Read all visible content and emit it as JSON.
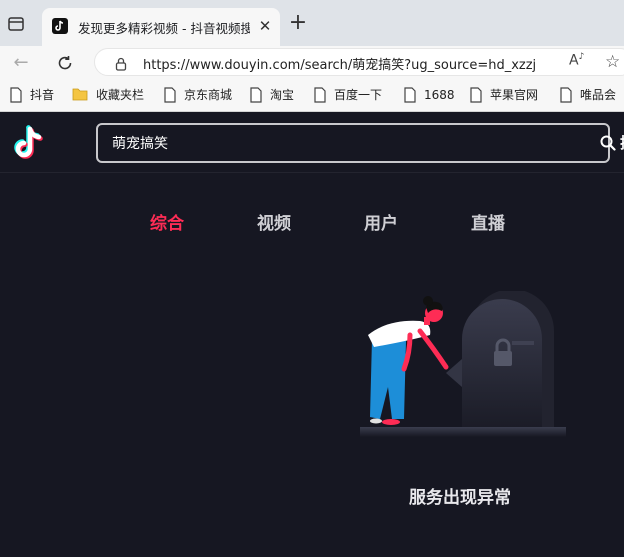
{
  "browser": {
    "tab_title": "发现更多精彩视频 - 抖音视频搜索",
    "url": "https://www.douyin.com/search/萌宠搞笑?ug_source=hd_xzzj",
    "bookmarks": [
      {
        "label": "抖音",
        "icon": "page-icon"
      },
      {
        "label": "收藏夹栏",
        "icon": "folder-icon"
      },
      {
        "label": "京东商城",
        "icon": "page-icon"
      },
      {
        "label": "淘宝",
        "icon": "page-icon"
      },
      {
        "label": "百度一下",
        "icon": "page-icon"
      },
      {
        "label": "1688",
        "icon": "page-icon"
      },
      {
        "label": "苹果官网",
        "icon": "page-icon"
      },
      {
        "label": "唯品会",
        "icon": "page-icon"
      }
    ]
  },
  "header": {
    "search_value": "萌宠搞笑",
    "search_button": "搜索"
  },
  "tabs": [
    {
      "label": "综合",
      "active": true
    },
    {
      "label": "视频",
      "active": false
    },
    {
      "label": "用户",
      "active": false
    },
    {
      "label": "直播",
      "active": false
    }
  ],
  "error": {
    "message": "服务出现异常"
  },
  "colors": {
    "accent": "#fe2c55",
    "background": "#161722",
    "logo_cyan": "#25f4ee"
  }
}
